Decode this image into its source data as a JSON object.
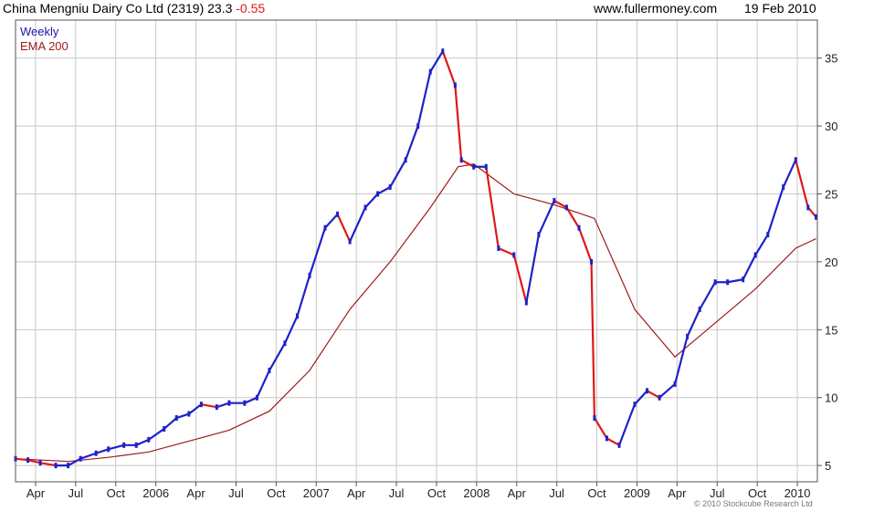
{
  "header": {
    "security": "China Mengniu Dairy Co Ltd (2319)",
    "price": "23.3",
    "change": "-0.55",
    "site": "www.fullermoney.com",
    "date": "19 Feb 2010"
  },
  "footer": {
    "copyright": "© 2010 Stockcube Research Ltd"
  },
  "colors": {
    "up": "#1e22c8",
    "down": "#e01818",
    "ema": "#9e1a1a",
    "grid": "#c8c8c8",
    "frame": "#555555",
    "weekly_label": "#1a1aa0"
  },
  "chart_data": {
    "type": "line",
    "title": "China Mengniu Dairy Co Ltd (2319) 23.3 -0.55",
    "xlabel": "",
    "ylabel": "",
    "x_ticks": [
      "Apr",
      "Jul",
      "Oct",
      "2006",
      "Apr",
      "Jul",
      "Oct",
      "2007",
      "Apr",
      "Jul",
      "Oct",
      "2008",
      "Apr",
      "Jul",
      "Oct",
      "2009",
      "Apr",
      "Jul",
      "Oct",
      "2010"
    ],
    "y_ticks": [
      5,
      10,
      15,
      20,
      25,
      30,
      35
    ],
    "xlim": [
      "2005-03-07",
      "2010-02-22"
    ],
    "ylim": [
      3.8,
      37.8
    ],
    "grid": true,
    "legend_position": "top-left",
    "series": [
      {
        "name": "Weekly",
        "style": "candlestick-approximated-as-close-line",
        "points": [
          [
            "2005-03-07",
            5.5
          ],
          [
            "2005-04-04",
            5.4
          ],
          [
            "2005-05-02",
            5.2
          ],
          [
            "2005-06-06",
            5.0
          ],
          [
            "2005-07-04",
            5.0
          ],
          [
            "2005-08-01",
            5.5
          ],
          [
            "2005-09-05",
            5.9
          ],
          [
            "2005-10-03",
            6.2
          ],
          [
            "2005-11-07",
            6.5
          ],
          [
            "2005-12-05",
            6.5
          ],
          [
            "2006-01-02",
            6.9
          ],
          [
            "2006-02-06",
            7.7
          ],
          [
            "2006-03-06",
            8.5
          ],
          [
            "2006-04-03",
            8.8
          ],
          [
            "2006-05-01",
            9.5
          ],
          [
            "2006-06-05",
            9.3
          ],
          [
            "2006-07-03",
            9.6
          ],
          [
            "2006-08-07",
            9.6
          ],
          [
            "2006-09-04",
            10.0
          ],
          [
            "2006-10-02",
            12.0
          ],
          [
            "2006-11-06",
            14.0
          ],
          [
            "2006-12-04",
            16.0
          ],
          [
            "2007-01-01",
            19.0
          ],
          [
            "2007-02-05",
            22.5
          ],
          [
            "2007-03-05",
            23.5
          ],
          [
            "2007-04-02",
            21.5
          ],
          [
            "2007-05-07",
            24.0
          ],
          [
            "2007-06-04",
            25.0
          ],
          [
            "2007-07-02",
            25.5
          ],
          [
            "2007-08-06",
            27.5
          ],
          [
            "2007-09-03",
            30.0
          ],
          [
            "2007-10-01",
            34.0
          ],
          [
            "2007-10-29",
            35.5
          ],
          [
            "2007-11-26",
            33.0
          ],
          [
            "2007-12-10",
            27.5
          ],
          [
            "2008-01-07",
            27.0
          ],
          [
            "2008-02-04",
            27.0
          ],
          [
            "2008-03-03",
            21.0
          ],
          [
            "2008-04-07",
            20.5
          ],
          [
            "2008-05-05",
            17.0
          ],
          [
            "2008-06-02",
            22.0
          ],
          [
            "2008-07-07",
            24.5
          ],
          [
            "2008-08-04",
            24.0
          ],
          [
            "2008-09-01",
            22.5
          ],
          [
            "2008-09-29",
            20.0
          ],
          [
            "2008-10-06",
            8.5
          ],
          [
            "2008-11-03",
            7.0
          ],
          [
            "2008-12-01",
            6.5
          ],
          [
            "2009-01-05",
            9.5
          ],
          [
            "2009-02-02",
            10.5
          ],
          [
            "2009-03-02",
            10.0
          ],
          [
            "2009-04-06",
            11.0
          ],
          [
            "2009-05-04",
            14.5
          ],
          [
            "2009-06-01",
            16.5
          ],
          [
            "2009-07-06",
            18.5
          ],
          [
            "2009-08-03",
            18.5
          ],
          [
            "2009-09-07",
            18.7
          ],
          [
            "2009-10-05",
            20.5
          ],
          [
            "2009-11-02",
            22.0
          ],
          [
            "2009-12-07",
            25.5
          ],
          [
            "2010-01-04",
            27.5
          ],
          [
            "2010-02-01",
            24.0
          ],
          [
            "2010-02-19",
            23.3
          ]
        ]
      },
      {
        "name": "EMA 200",
        "style": "line",
        "points": [
          [
            "2005-03-07",
            5.5
          ],
          [
            "2005-07-04",
            5.3
          ],
          [
            "2005-10-03",
            5.6
          ],
          [
            "2006-01-02",
            6.0
          ],
          [
            "2006-04-03",
            6.8
          ],
          [
            "2006-07-03",
            7.6
          ],
          [
            "2006-10-02",
            9.0
          ],
          [
            "2007-01-01",
            12.0
          ],
          [
            "2007-04-02",
            16.5
          ],
          [
            "2007-07-02",
            20.0
          ],
          [
            "2007-10-01",
            24.0
          ],
          [
            "2007-12-03",
            27.0
          ],
          [
            "2008-01-07",
            27.2
          ],
          [
            "2008-04-07",
            25.0
          ],
          [
            "2008-07-07",
            24.2
          ],
          [
            "2008-10-06",
            23.2
          ],
          [
            "2009-01-05",
            16.5
          ],
          [
            "2009-04-06",
            13.0
          ],
          [
            "2009-07-06",
            15.5
          ],
          [
            "2009-10-05",
            18.0
          ],
          [
            "2010-01-04",
            21.0
          ],
          [
            "2010-02-19",
            21.7
          ]
        ]
      }
    ]
  }
}
